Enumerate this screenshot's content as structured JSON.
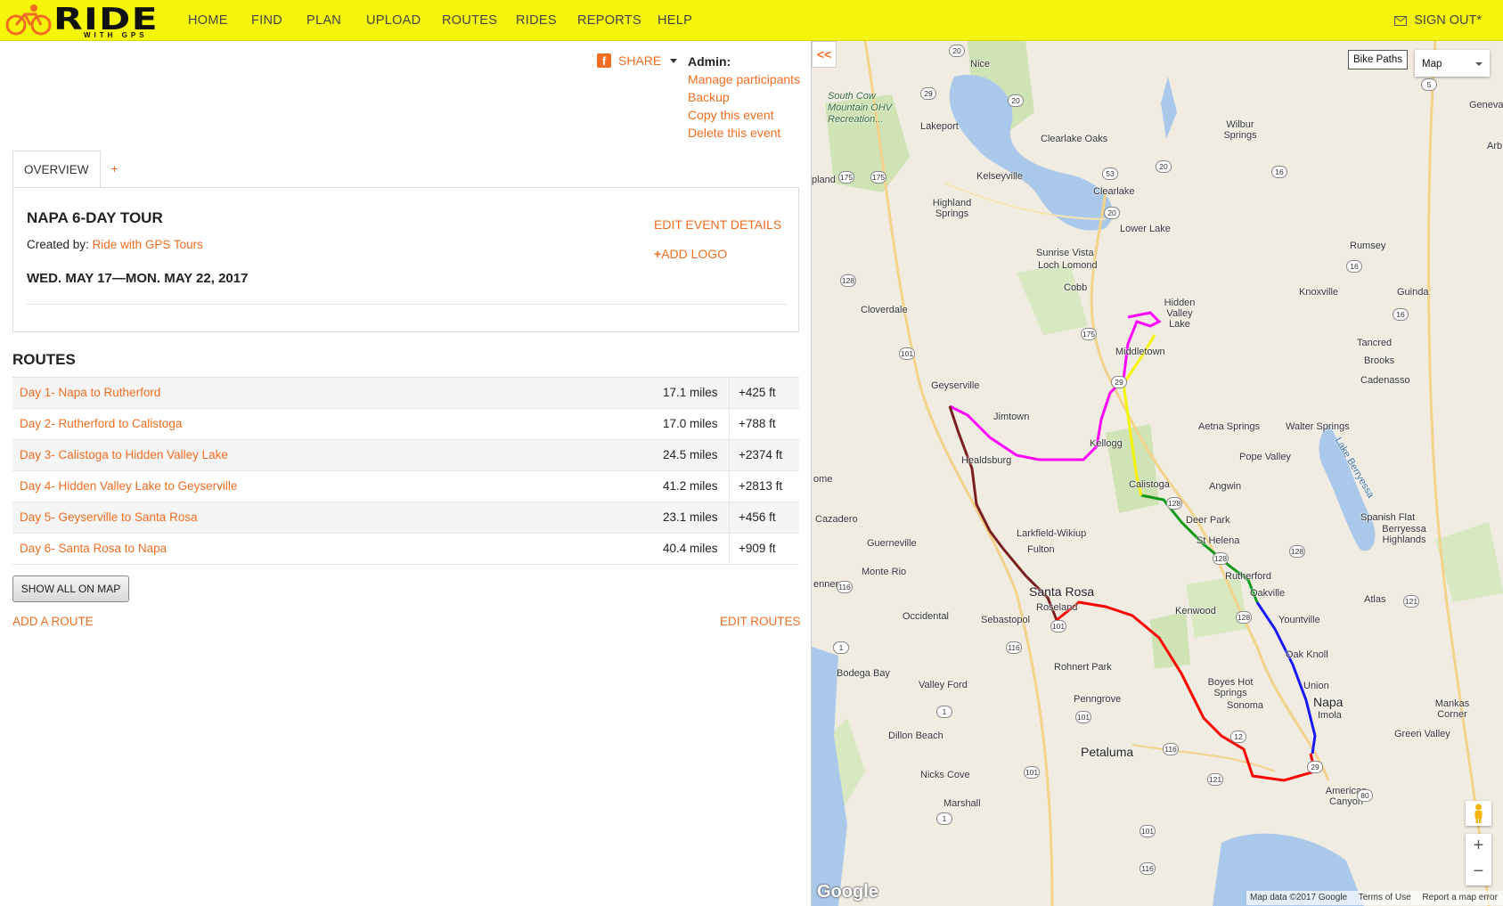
{
  "topnav": {
    "logo_word": "RIDE",
    "logo_sub": "WITH GPS",
    "items": [
      "HOME",
      "FIND",
      "PLAN",
      "UPLOAD",
      "ROUTES",
      "RIDES",
      "REPORTS",
      "HELP"
    ],
    "active_item": "REPORTS",
    "signout_label": "SIGN OUT*",
    "colors": {
      "background": "#f5f50a",
      "accent": "#f26d21"
    }
  },
  "share": {
    "label": "SHARE"
  },
  "admin": {
    "heading": "Admin:",
    "links": [
      "Manage participants",
      "Backup",
      "Copy this event",
      "Delete this event"
    ]
  },
  "tabs": {
    "overview": "OVERVIEW",
    "add": "+"
  },
  "event": {
    "title": "NAPA 6-DAY TOUR",
    "created_by_label": "Created by:",
    "creator": "Ride with GPS Tours",
    "dates": "WED. MAY 17—MON. MAY 22, 2017",
    "edit_label": "EDIT EVENT DETAILS",
    "add_logo_label": "ADD LOGO"
  },
  "routes": {
    "heading": "ROUTES",
    "rows": [
      {
        "name": "Day 1- Napa to Rutherford",
        "distance": "17.1 miles",
        "elevation": "+425 ft"
      },
      {
        "name": "Day 2- Rutherford to Calistoga",
        "distance": "17.0 miles",
        "elevation": "+788 ft"
      },
      {
        "name": "Day 3- Calistoga to Hidden Valley Lake",
        "distance": "24.5 miles",
        "elevation": "+2374 ft"
      },
      {
        "name": "Day 4- Hidden Valley Lake to Geyserville",
        "distance": "41.2 miles",
        "elevation": "+2813 ft"
      },
      {
        "name": "Day 5- Geyserville to Santa Rosa",
        "distance": "23.1 miles",
        "elevation": "+456 ft"
      },
      {
        "name": "Day 6- Santa Rosa to Napa",
        "distance": "40.4 miles",
        "elevation": "+909 ft"
      }
    ],
    "show_all_label": "SHOW ALL ON MAP",
    "add_route_label": "ADD A ROUTE",
    "edit_routes_label": "EDIT ROUTES"
  },
  "map": {
    "collapse_label": "<<",
    "bike_paths_label": "Bike Paths",
    "map_type": "Map",
    "zoom_in": "+",
    "zoom_out": "−",
    "google_label": "Google",
    "attribution": [
      "Map data ©2017 Google",
      "Terms of Use",
      "Report a map error"
    ],
    "route_colors": [
      "#1a1aff",
      "#0f9a1a",
      "#f5f500",
      "#ff00ff",
      "#7a1f1f",
      "#ff0000"
    ],
    "places": {
      "nice": "Nice",
      "south_cow": "South Cow Mountain OHV Recreation...",
      "lakeport": "Lakeport",
      "clearlake_oaks": "Clearlake Oaks",
      "wilbur": "Wilbur Springs",
      "kelseyville": "Kelseyville",
      "clearlake": "Clearlake",
      "highland": "Highland Springs",
      "lower_lake": "Lower Lake",
      "rumsey": "Rumsey",
      "sunrise": "Sunrise Vista",
      "loch_lomond": "Loch Lomond",
      "cobb": "Cobb",
      "knoxville": "Knoxville",
      "guinda": "Guinda",
      "cloverdale": "Cloverdale",
      "hidden_valley": "Hidden Valley Lake",
      "middletown": "Middletown",
      "tancred": "Tancred",
      "brooks": "Brooks",
      "cadenasso": "Cadenasso",
      "geyserville": "Geyserville",
      "jimtown": "Jimtown",
      "kellogg": "Kellogg",
      "aetna": "Aetna Springs",
      "walter": "Walter Springs",
      "lake_berryessa": "Lake Berryessa",
      "pope_valley": "Pope Valley",
      "healdsburg": "Healdsburg",
      "calistoga": "Calistoga",
      "angwin": "Angwin",
      "cazadero": "Cazadero",
      "deer_park": "Deer Park",
      "spanish_flat": "Spanish Flat",
      "berryessa_highlands": "Berryessa Highlands",
      "guerneville": "Guerneville",
      "larkfield": "Larkfield-Wikiup",
      "st_helena": "St Helena",
      "fulton": "Fulton",
      "monte_rio": "Monte Rio",
      "rutherford": "Rutherford",
      "santa_rosa": "Santa Rosa",
      "oakville": "Oakville",
      "atlas": "Atlas",
      "occidental": "Occidental",
      "roseland": "Roseland",
      "kenwood": "Kenwood",
      "sebastopol": "Sebastopol",
      "yountville": "Yountville",
      "rohnert_park": "Rohnert Park",
      "oak_knoll": "Oak Knoll",
      "bodega_bay": "Bodega Bay",
      "valley_ford": "Valley Ford",
      "boyes": "Boyes Hot Springs",
      "sonoma": "Sonoma",
      "union": "Union",
      "napa": "Napa",
      "penngrove": "Penngrove",
      "imola": "Imola",
      "monkes_corner": "Mankas Corner",
      "dillon_beach": "Dillon Beach",
      "green_valley": "Green Valley",
      "petaluma": "Petaluma",
      "nicks_cove": "Nicks Cove",
      "american_canyon": "American Canyon",
      "marshall": "Marshall",
      "geneva": "Geneva",
      "arbuckle": "Arb",
      "upland": "pland",
      "jenner": "enner",
      "ome": "ome"
    },
    "shields": [
      "20",
      "29",
      "20",
      "5",
      "175",
      "175",
      "53",
      "20",
      "16",
      "20",
      "16",
      "128",
      "16",
      "101",
      "175",
      "29",
      "128",
      "128",
      "128",
      "128",
      "116",
      "101",
      "121",
      "12",
      "101",
      "1",
      "116",
      "1",
      "101",
      "1",
      "116",
      "121",
      "29",
      "80",
      "101",
      "116"
    ]
  }
}
